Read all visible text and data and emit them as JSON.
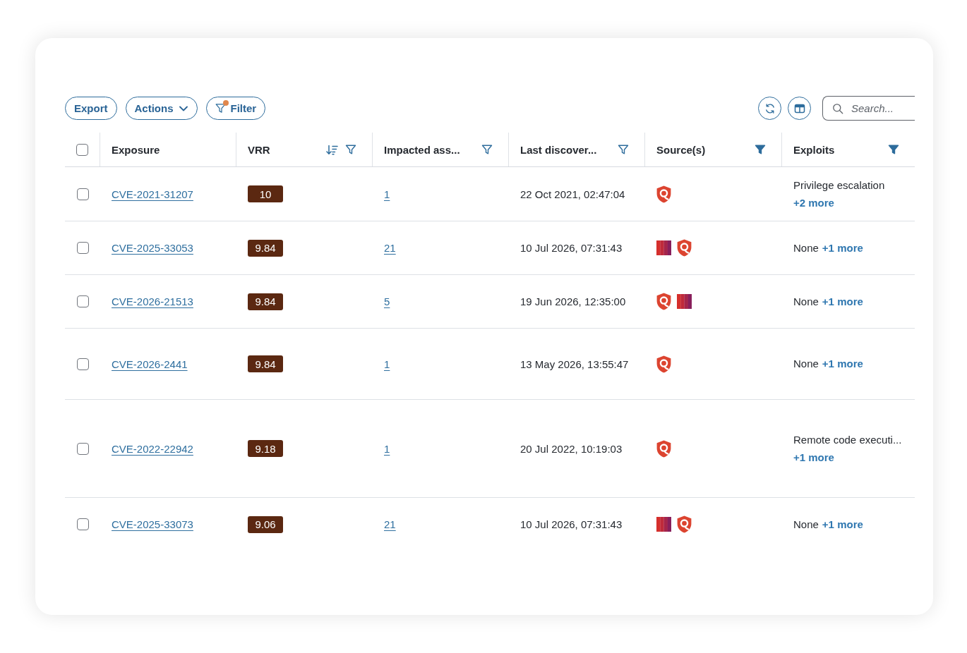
{
  "toolbar": {
    "export_button": {
      "label": "Export"
    },
    "actions_menu": {
      "label": "Actions"
    },
    "filter_button": {
      "label": "Filter",
      "applied": true
    },
    "search": {
      "placeholder": "Search..."
    }
  },
  "table": {
    "select_all": {
      "checked": false
    },
    "columns": [
      {
        "label": "Exposure",
        "sorted": false,
        "filterable": false
      },
      {
        "label": "VRR",
        "sorted": true,
        "filterable": true,
        "filtered": false
      },
      {
        "label": "Impacted ass...",
        "sorted": false,
        "filterable": true,
        "filtered": false
      },
      {
        "label": "Last discover...",
        "sorted": false,
        "filterable": true,
        "filtered": false
      },
      {
        "label": "Source(s)",
        "sorted": false,
        "filterable": true,
        "filtered": true
      },
      {
        "label": "Exploits",
        "sorted": false,
        "filterable": true,
        "filtered": true
      }
    ],
    "rows": [
      {
        "checked": false,
        "exposure": "CVE-2021-31207",
        "vrr": "10",
        "impacted_assets": "1",
        "last_discovered": "22 Oct 2021, 02:47:04",
        "sources": [
          {
            "kind": "shield"
          }
        ],
        "exploits": {
          "text": "Privilege escalation",
          "more": "+2 more"
        }
      },
      {
        "checked": false,
        "exposure": "CVE-2025-33053",
        "vrr": "9.84",
        "impacted_assets": "21",
        "last_discovered": "10 Jul 2026, 07:31:43",
        "sources": [
          {
            "kind": "stripes"
          },
          {
            "kind": "shield"
          }
        ],
        "exploits": {
          "text": "None",
          "more": "+1 more"
        }
      },
      {
        "checked": false,
        "exposure": "CVE-2026-21513",
        "vrr": "9.84",
        "impacted_assets": "5",
        "last_discovered": "19 Jun 2026, 12:35:00",
        "sources": [
          {
            "kind": "shield"
          },
          {
            "kind": "stripes"
          }
        ],
        "exploits": {
          "text": "None",
          "more": "+1 more"
        }
      },
      {
        "checked": false,
        "exposure": "CVE-2026-2441",
        "vrr": "9.84",
        "impacted_assets": "1",
        "last_discovered": "13 May 2026, 13:55:47",
        "sources": [
          {
            "kind": "shield"
          }
        ],
        "exploits": {
          "text": "None",
          "more": "+1 more"
        }
      },
      {
        "checked": false,
        "exposure": "CVE-2022-22942",
        "vrr": "9.18",
        "impacted_assets": "1",
        "last_discovered": "20 Jul 2022, 10:19:03",
        "sources": [
          {
            "kind": "shield"
          }
        ],
        "exploits": {
          "text": "Remote code executi...",
          "more": "+1 more"
        }
      },
      {
        "checked": false,
        "exposure": "CVE-2025-33073",
        "vrr": "9.06",
        "impacted_assets": "21",
        "last_discovered": "10 Jul 2026, 07:31:43",
        "sources": [
          {
            "kind": "stripes"
          },
          {
            "kind": "shield"
          }
        ],
        "exploits": {
          "text": "None",
          "more": "+1 more"
        }
      }
    ]
  }
}
